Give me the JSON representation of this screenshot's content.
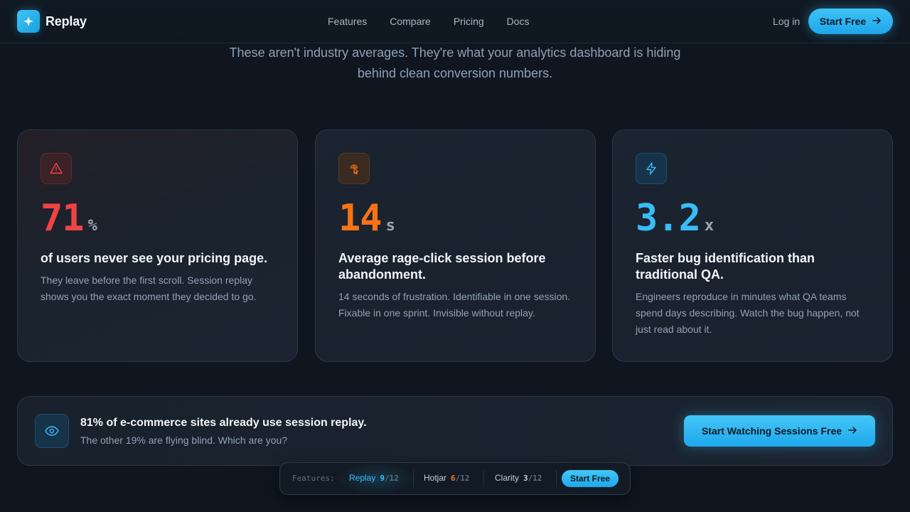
{
  "nav": {
    "brand": "Replay",
    "links": [
      "Features",
      "Compare",
      "Pricing",
      "Docs"
    ],
    "login": "Log in",
    "cta": "Start Free"
  },
  "intro": {
    "line1": "These aren't industry averages. They're what your analytics dashboard is hiding",
    "line2": "behind clean conversion numbers."
  },
  "stats": [
    {
      "icon": "warning-triangle-icon",
      "value": "71",
      "unit": "%",
      "title": "of users never see your pricing page.",
      "description": "They leave before the first scroll. Session replay shows you the exact moment they decided to go."
    },
    {
      "icon": "pointer-tap-icon",
      "value": "14",
      "unit": "s",
      "title": "Average rage-click session before abandonment.",
      "description": "14 seconds of frustration. Identifiable in one session. Fixable in one sprint. Invisible without replay."
    },
    {
      "icon": "lightning-bolt-icon",
      "value": "3.2",
      "unit": "x",
      "title": "Faster bug identification than traditional QA.",
      "description": "Engineers reproduce in minutes what QA teams spend days describing. Watch the bug happen, not just read about it."
    }
  ],
  "banner": {
    "icon": "eye-icon",
    "title": "81% of e-commerce sites already use session replay.",
    "subtitle": "The other 19% are flying blind. Which are you?",
    "cta": "Start Watching Sessions Free"
  },
  "compare_bar": {
    "label": "Features:",
    "items": [
      {
        "name": "Replay",
        "score": "9",
        "total": "/12"
      },
      {
        "name": "Hotjar",
        "score": "6",
        "total": "/12"
      },
      {
        "name": "Clarity",
        "score": "3",
        "total": "/12"
      }
    ],
    "cta": "Start Free"
  },
  "colors": {
    "accent": "#38bdf8",
    "danger": "#ef4444",
    "warning": "#f97316",
    "background": "#0f1620"
  }
}
